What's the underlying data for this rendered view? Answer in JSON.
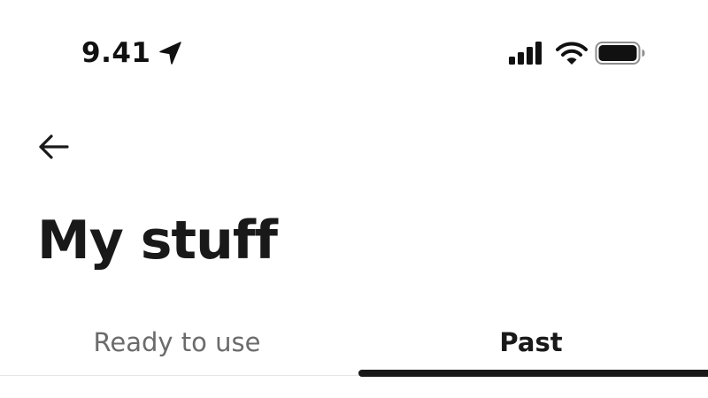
{
  "status_bar": {
    "time": "9.41",
    "icons": [
      "location-arrow-icon",
      "cellular-signal-icon",
      "wifi-icon",
      "battery-icon"
    ]
  },
  "header": {
    "back_icon": "arrow-left-icon",
    "title": "My stuff"
  },
  "tabs": [
    {
      "label": "Ready to use",
      "selected": false
    },
    {
      "label": "Past",
      "selected": true
    }
  ],
  "colors": {
    "text_primary": "#191919",
    "text_secondary": "#6b6b6b",
    "indicator": "#191919",
    "divider": "#e6e6e6",
    "background": "#ffffff"
  }
}
